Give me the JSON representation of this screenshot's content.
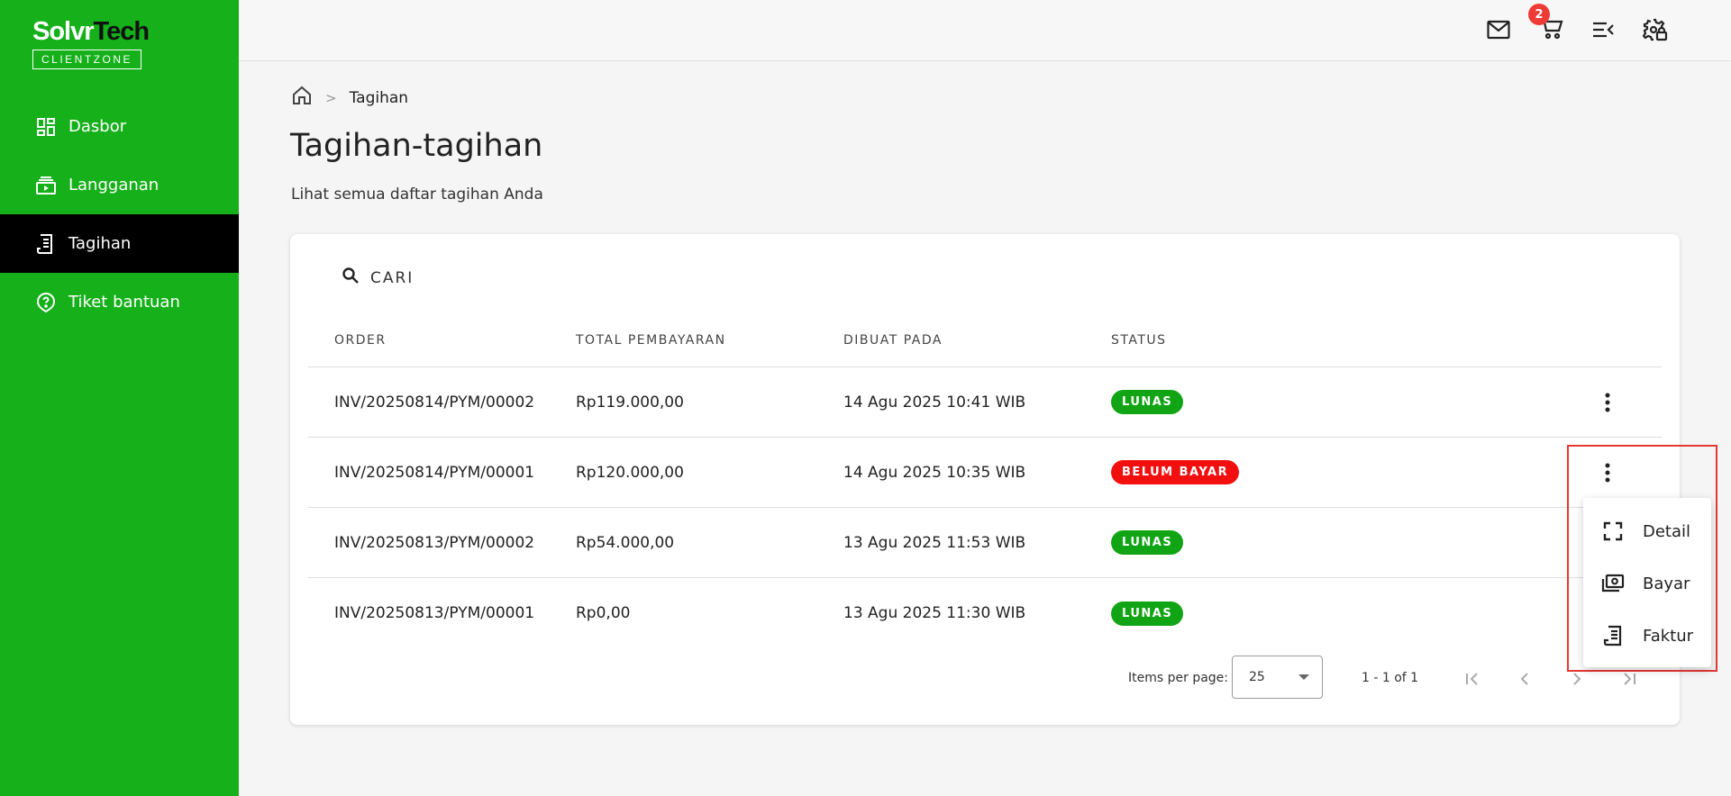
{
  "brand": {
    "name_part1": "Solvr",
    "name_part2": "Tech",
    "subtitle": "CLIENTZONE"
  },
  "sidebar": {
    "items": [
      {
        "label": "Dasbor",
        "icon": "dashboard-icon",
        "active": false
      },
      {
        "label": "Langganan",
        "icon": "subscriptions-icon",
        "active": false
      },
      {
        "label": "Tagihan",
        "icon": "receipt-icon",
        "active": true
      },
      {
        "label": "Tiket bantuan",
        "icon": "help-icon",
        "active": false
      }
    ]
  },
  "topbar": {
    "cart_badge": "2"
  },
  "breadcrumb": {
    "separator": ">",
    "current": "Tagihan"
  },
  "page": {
    "title": "Tagihan-tagihan",
    "subtitle": "Lihat semua daftar tagihan Anda"
  },
  "search": {
    "label": "CARI"
  },
  "table": {
    "headers": [
      "ORDER",
      "TOTAL PEMBAYARAN",
      "DIBUAT PADA",
      "STATUS"
    ],
    "rows": [
      {
        "order": "INV/20250814/PYM/00002",
        "total": "Rp119.000,00",
        "created": "14 Agu 2025 10:41 WIB",
        "status": "LUNAS",
        "status_color": "#11a414"
      },
      {
        "order": "INV/20250814/PYM/00001",
        "total": "Rp120.000,00",
        "created": "14 Agu 2025 10:35 WIB",
        "status": "BELUM BAYAR",
        "status_color": "#f20f0f"
      },
      {
        "order": "INV/20250813/PYM/00002",
        "total": "Rp54.000,00",
        "created": "13 Agu 2025 11:53 WIB",
        "status": "LUNAS",
        "status_color": "#11a414"
      },
      {
        "order": "INV/20250813/PYM/00001",
        "total": "Rp0,00",
        "created": "13 Agu 2025 11:30 WIB",
        "status": "LUNAS",
        "status_color": "#11a414"
      }
    ]
  },
  "paginator": {
    "items_label": "Items per page:",
    "page_size": "25",
    "range": "1 - 1 of 1"
  },
  "context_menu": {
    "items": [
      {
        "label": "Detail",
        "icon": "fullscreen-icon"
      },
      {
        "label": "Bayar",
        "icon": "payments-icon"
      },
      {
        "label": "Faktur",
        "icon": "invoice-icon"
      }
    ]
  },
  "colors": {
    "sidebar_bg": "#15b01a",
    "active_bg": "#000000",
    "badge": "#ef3b36",
    "highlight": "#e53935"
  }
}
